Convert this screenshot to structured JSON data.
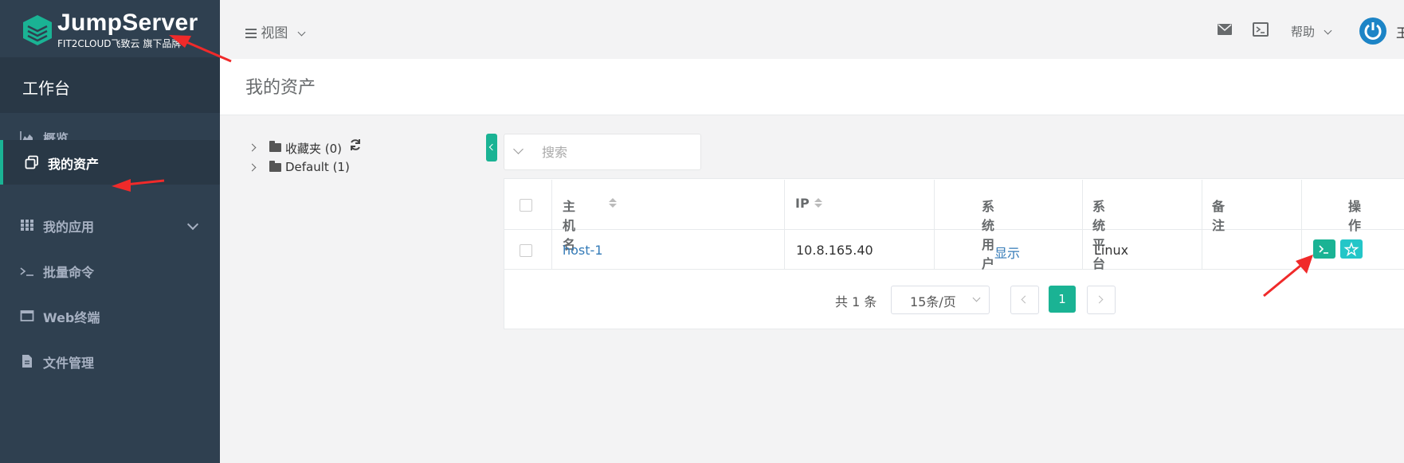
{
  "app": {
    "brand_title": "JumpServer",
    "brand_sub": "FIT2CLOUD飞致云 旗下品牌"
  },
  "sidebar": {
    "section_title": "工作台",
    "items": [
      {
        "label": "概览",
        "icon": "chart-area-icon"
      },
      {
        "label": "我的资产",
        "icon": "assets-icon",
        "active": true
      },
      {
        "label": "我的应用",
        "icon": "grid-icon",
        "has_children": true
      },
      {
        "label": "批量命令",
        "icon": "terminal-prompt-icon"
      },
      {
        "label": "Web终端",
        "icon": "window-icon"
      },
      {
        "label": "文件管理",
        "icon": "file-icon"
      }
    ]
  },
  "topbar": {
    "view_label": "视图",
    "help_label": "帮助",
    "user_initial": "王"
  },
  "page": {
    "title": "我的资产"
  },
  "tree": {
    "nodes": [
      {
        "label": "收藏夹 (0)"
      },
      {
        "label": "Default (1)"
      }
    ]
  },
  "search": {
    "placeholder": "搜索"
  },
  "table": {
    "headers": {
      "hostname": "主机名",
      "ip": "IP",
      "system_user": "系统用户",
      "platform": "系统平台",
      "comment": "备注",
      "actions": "操作"
    },
    "rows": [
      {
        "hostname": "host-1",
        "ip": "10.8.165.40",
        "system_user": "显示",
        "platform": "Linux",
        "comment": ""
      }
    ]
  },
  "pagination": {
    "total": "共 1 条",
    "page_size": "15条/页",
    "current": "1"
  },
  "colors": {
    "sidebar": "#2f4050",
    "accent": "#1ab394",
    "accent2": "#23c6c8",
    "annotation": "#f02a2a",
    "avatar": "#1c84c6"
  }
}
